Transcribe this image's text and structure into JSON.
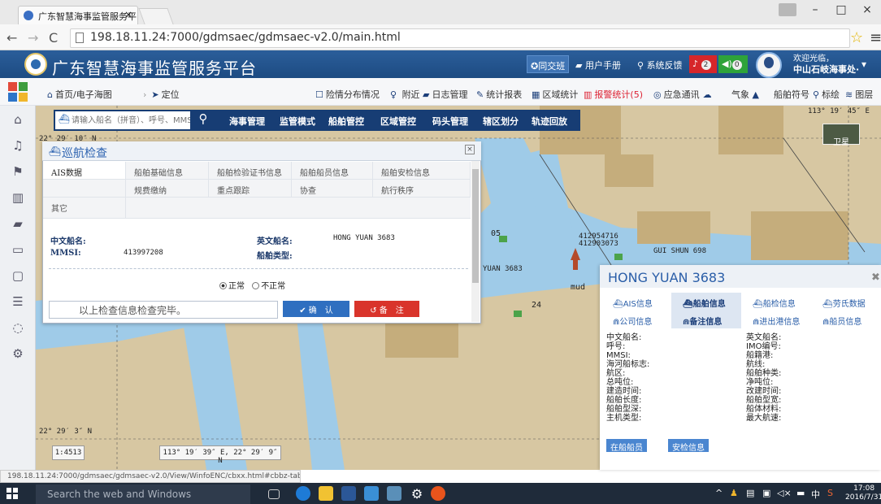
{
  "browser": {
    "tab_title": "广东智慧海事监管服务平",
    "tab_close": "×",
    "url": "198.18.11.24:7000/gdmsaec/gdmsaec-v2.0/main.html",
    "minimize": "–",
    "maximize": "□",
    "close": "×",
    "status_url": "198.18.11.24:7000/gdmsaec/gdmsaec-v2.0/View/WinfoENC/cbxx.html#cbbz-tab"
  },
  "header": {
    "title": "广东智慧海事监管服务平台",
    "duty": "同交班",
    "manual": "用户手册",
    "feedback": "系统反馈",
    "bell_count": "2",
    "sound_count": "0",
    "welcome": "欢迎光临，",
    "user": "中山石岐海事处·"
  },
  "toolbar": {
    "home": "首页/电子海图",
    "locate": "定位",
    "danger": "险情分布情况",
    "nearby": "附近",
    "log": "日志管理",
    "stats": "统计报表",
    "region": "区域统计",
    "alarm": "报警统计(5)",
    "emergency": "应急通讯",
    "weather": "气象",
    "ship_symbol": "船舶符号",
    "mark": "标绘",
    "layer": "图层"
  },
  "search": {
    "placeholder": "请输入船名（拼音）、呼号、MMSI",
    "menu": [
      "海事管理",
      "监管模式",
      "船舶管控",
      "区域管控",
      "码头管理",
      "辖区划分",
      "轨迹回放"
    ]
  },
  "patrol": {
    "title": "巡航检查",
    "tabs_row1": [
      "AIS数据",
      "船舶基础信息",
      "船舶检验证书信息",
      "船舶船员信息",
      "船舶安检信息"
    ],
    "tabs_row2": [
      "规费缴纳",
      "重点跟踪",
      "协查",
      "航行秩序"
    ],
    "tab_other": "其它",
    "cn_name_label": "中文船名:",
    "en_name_label": "英文船名:",
    "en_name_value": "HONG YUAN 3683",
    "mmsi_label": "MMSI:",
    "mmsi_value": "413997208",
    "ship_type_label": "船舶类型:",
    "radio_normal": "正常",
    "radio_abnormal": "不正常",
    "check_text": "以上检查信息检查完毕。",
    "confirm": "确　认",
    "remark": "备　注"
  },
  "ship_panel": {
    "title": "HONG YUAN 3683",
    "tabs_row1": [
      "AIS信息",
      "船舶信息",
      "船检信息",
      "劳氏数据"
    ],
    "tabs_row2": [
      "公司信息",
      "备注信息",
      "进出港信息",
      "船员信息"
    ],
    "left_fields": [
      "中文船名:",
      "呼号:",
      "MMSI:",
      "海河船标志:",
      "航区:",
      "总吨位:",
      "建造时间:",
      "船舶长度:",
      "船舶型深:",
      "主机类型:"
    ],
    "right_fields": [
      "英文船名:",
      "IMO编号:",
      "船籍港:",
      "航线:",
      "船舶种类:",
      "净吨位:",
      "改建时间:",
      "船舶型宽:",
      "船体材料:",
      "最大航速:"
    ],
    "btn_crew": "在船船员",
    "btn_safety": "安检信息"
  },
  "map": {
    "coord_top_right": "113° 19′ 45″ E",
    "coord_top_left": "22° 29′ 10″ N",
    "coord_bottom_left": "22° 29′ 3″ N",
    "scale": "1:4513",
    "cursor_coord": "113° 19′ 39″ E, 22° 29′ 9″ N",
    "satellite": "卫星",
    "mud": "mud",
    "ship_label": "YUAN 3683",
    "mmsi_a": "412954716",
    "mmsi_b": "412903073",
    "gui_shun": "GUI SHUN 698",
    "num_24": "24",
    "num_05": "05"
  },
  "taskbar": {
    "search": "Search the web and Windows",
    "time": "17:08",
    "date": "2016/7/31"
  }
}
